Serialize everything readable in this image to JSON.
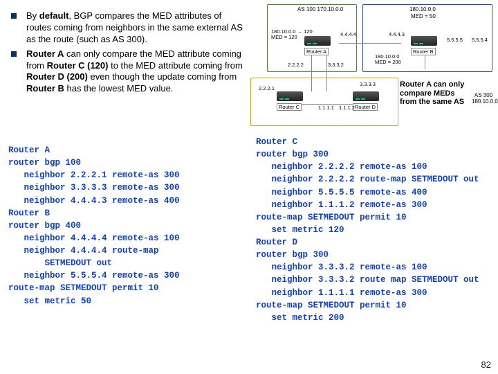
{
  "bullets": {
    "b1_pre": "By ",
    "b1_bold1": "default",
    "b1_mid": ", BGP compares the MED attributes of routes coming from neighbors in the same external AS as the route (such as AS 300).",
    "b2_bold1": "Router A",
    "b2_mid1": " can only compare the MED attribute coming from ",
    "b2_bold2": "Router C (120)",
    "b2_mid2": " to the MED attribute coming from ",
    "b2_bold3": "Router D (200)",
    "b2_mid3": " even though the update coming from ",
    "b2_bold4": "Router B",
    "b2_mid4": " has the lowest MED value."
  },
  "config_left": "Router A\nrouter bgp 100\n   neighbor 2.2.2.1 remote-as 300\n   neighbor 3.3.3.3 remote-as 300\n   neighbor 4.4.4.3 remote-as 400\nRouter B\nrouter bgp 400\n   neighbor 4.4.4.4 remote-as 100\n   neighbor 4.4.4.4 route-map\n       SETMEDOUT out\n   neighbor 5.5.5.4 remote-as 300\nroute-map SETMEDOUT permit 10\n   set metric 50",
  "config_right": "Router C\nrouter bgp 300\n   neighbor 2.2.2.2 remote-as 100\n   neighbor 2.2.2.2 route-map SETMEDOUT out\n   neighbor 5.5.5.5 remote-as 400\n   neighbor 1.1.1.2 remote-as 300\nroute-map SETMEDOUT permit 10\n   set metric 120\nRouter D\nrouter bgp 300\n   neighbor 3.3.3.2 remote-as 100\n   neighbor 3.3.3.2 route map SETMEDOUT out\n   neighbor 1.1.1.1 remote-as 300\nroute-map SETMEDOUT permit 10\n   set metric 200",
  "diagram": {
    "as100": "AS 100\n170.10.0.0",
    "as400_1": "180.10.0.0",
    "as400_2": "MED = 50",
    "as300": "AS 300\n180.10.0.0",
    "rA": "Router A",
    "rB": "Router B",
    "rC": "Router C",
    "rD": "Router D",
    "ip_4444": "4.4.4.4",
    "ip_4443": "4.4.4.3",
    "ip_2222": "2.2.2.2",
    "ip_2221": "2.2.2.1",
    "ip_3332": "3.3.3.2",
    "ip_3333": "3.3.3.3",
    "ip_1111": "1.1.1.1",
    "ip_1112": "1.1.1.2",
    "ip_5555": "5.5.5.5",
    "ip_5554": "5.5.5.4",
    "med120": "180.10.0.0 → 120\nMED = 120",
    "med200": "180.10.0.0\nMED = 200",
    "callout": "Router A can only compare MEDs from the same AS"
  },
  "pagenum": "82"
}
